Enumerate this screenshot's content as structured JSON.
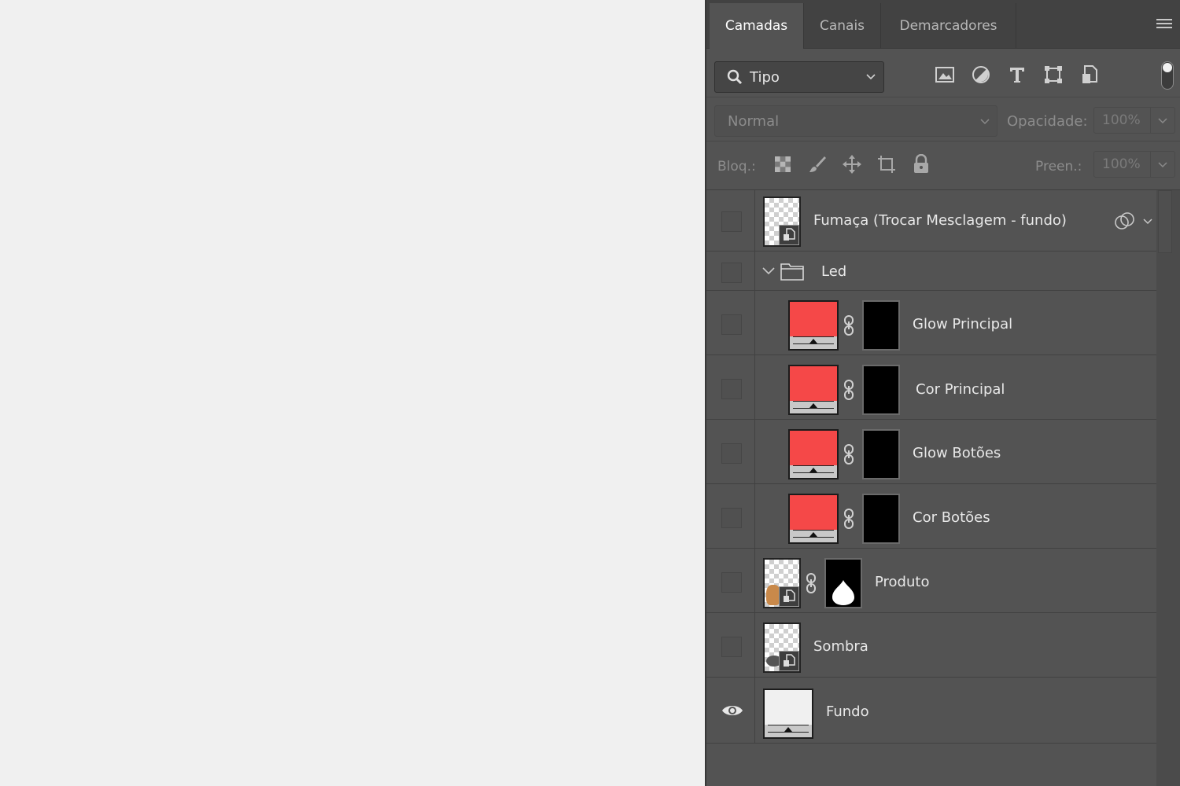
{
  "tabs": [
    {
      "label": "Camadas",
      "active": true
    },
    {
      "label": "Canais",
      "active": false
    },
    {
      "label": "Demarcadores",
      "active": false
    }
  ],
  "filter": {
    "value": "Tipo",
    "icons": [
      "image-filter-icon",
      "adjustment-filter-icon",
      "type-filter-icon",
      "shape-filter-icon",
      "smart-object-filter-icon"
    ]
  },
  "blend": {
    "mode": "Normal",
    "opacity_label": "Opacidade:",
    "opacity_value": "100%"
  },
  "lock": {
    "label": "Bloq.:",
    "fill_label": "Preen.:",
    "fill_value": "100%"
  },
  "layers": [
    {
      "name": "Fumaça (Trocar Mesclagem - fundo)",
      "type": "smart-object",
      "visible": false
    },
    {
      "name": "Led",
      "type": "group",
      "visible": false,
      "expanded": true
    },
    {
      "name": "Glow Principal",
      "type": "solid-fill",
      "color": "#f54848",
      "visible": false,
      "in_group": true
    },
    {
      "name": "Cor Principal",
      "type": "solid-fill",
      "color": "#f54848",
      "visible": false,
      "in_group": true
    },
    {
      "name": "Glow Botões",
      "type": "solid-fill",
      "color": "#f54848",
      "visible": false,
      "in_group": true
    },
    {
      "name": "Cor Botões",
      "type": "solid-fill",
      "color": "#f54848",
      "visible": false,
      "in_group": true
    },
    {
      "name": "Produto",
      "type": "smart-object",
      "visible": false,
      "has_mask": true
    },
    {
      "name": "Sombra",
      "type": "smart-object",
      "visible": false
    },
    {
      "name": "Fundo",
      "type": "solid-fill",
      "color": "#f0f0f0",
      "visible": true
    }
  ]
}
